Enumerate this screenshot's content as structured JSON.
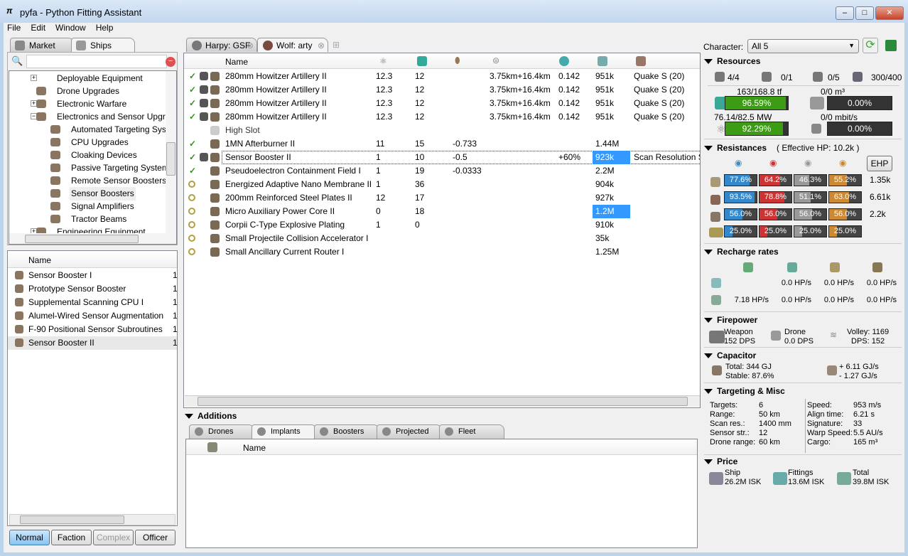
{
  "window": {
    "title": "pyfa - Python Fitting Assistant",
    "min": "–",
    "max": "□",
    "close": "✕"
  },
  "menu": [
    "File",
    "Edit",
    "Window",
    "Help"
  ],
  "left": {
    "tabs": [
      "Market",
      "Ships"
    ],
    "search_placeholder": "",
    "tree": [
      {
        "label": "Deployable Equipment",
        "level": 0,
        "expander": "+"
      },
      {
        "label": "Drone Upgrades",
        "level": 0,
        "expander": ""
      },
      {
        "label": "Electronic Warfare",
        "level": 0,
        "expander": "+"
      },
      {
        "label": "Electronics and Sensor Upgrad",
        "level": 0,
        "expander": "−"
      },
      {
        "label": "Automated Targeting Syst",
        "level": 1
      },
      {
        "label": "CPU Upgrades",
        "level": 1
      },
      {
        "label": "Cloaking Devices",
        "level": 1
      },
      {
        "label": "Passive Targeting Systems",
        "level": 1
      },
      {
        "label": "Remote Sensor Boosters",
        "level": 1
      },
      {
        "label": "Sensor Boosters",
        "level": 1,
        "selected": true
      },
      {
        "label": "Signal Amplifiers",
        "level": 1
      },
      {
        "label": "Tractor Beams",
        "level": 1
      },
      {
        "label": "Engineering Equipment",
        "level": 0,
        "expander": "+"
      }
    ],
    "list_header": "Name",
    "items": [
      {
        "name": "Sensor Booster I",
        "meta": "1"
      },
      {
        "name": "Prototype Sensor Booster",
        "meta": "1"
      },
      {
        "name": "Supplemental Scanning CPU I",
        "meta": "1"
      },
      {
        "name": "Alumel-Wired Sensor Augmentation",
        "meta": "1"
      },
      {
        "name": "F-90 Positional Sensor Subroutines",
        "meta": "1"
      },
      {
        "name": "Sensor Booster II",
        "meta": "1",
        "selected": true
      }
    ],
    "meta_buttons": [
      "Normal",
      "Faction",
      "Complex",
      "Officer"
    ]
  },
  "fit_tabs": [
    "Harpy: GSF",
    "Wolf: arty"
  ],
  "fitting": {
    "header": "Name",
    "rows": [
      {
        "state": "on",
        "name": "280mm Howitzer Artillery II",
        "cpu": "12.3",
        "pg": "12",
        "cap": "",
        "range": "3.75km+16.4km",
        "misc": "0.142",
        "price": "951k",
        "charge": "Quake S (20)"
      },
      {
        "state": "on",
        "name": "280mm Howitzer Artillery II",
        "cpu": "12.3",
        "pg": "12",
        "cap": "",
        "range": "3.75km+16.4km",
        "misc": "0.142",
        "price": "951k",
        "charge": "Quake S (20)"
      },
      {
        "state": "on",
        "name": "280mm Howitzer Artillery II",
        "cpu": "12.3",
        "pg": "12",
        "cap": "",
        "range": "3.75km+16.4km",
        "misc": "0.142",
        "price": "951k",
        "charge": "Quake S (20)"
      },
      {
        "state": "on",
        "name": "280mm Howitzer Artillery II",
        "cpu": "12.3",
        "pg": "12",
        "cap": "",
        "range": "3.75km+16.4km",
        "misc": "0.142",
        "price": "951k",
        "charge": "Quake S (20)"
      },
      {
        "state": "",
        "name": "High Slot",
        "cpu": "",
        "pg": "",
        "cap": "",
        "range": "",
        "misc": "",
        "price": "",
        "charge": ""
      },
      {
        "state": "on",
        "name": "1MN Afterburner II",
        "cpu": "11",
        "pg": "15",
        "cap": "-0.733",
        "range": "",
        "misc": "",
        "price": "1.44M",
        "charge": ""
      },
      {
        "state": "on",
        "name": "Sensor Booster II",
        "cpu": "1",
        "pg": "10",
        "cap": "-0.5",
        "range": "",
        "misc": "+60%",
        "price": "923k",
        "charge": "Scan Resolution S",
        "selected": true
      },
      {
        "state": "on",
        "name": "Pseudoelectron Containment Field I",
        "cpu": "1",
        "pg": "19",
        "cap": "-0.0333",
        "range": "",
        "misc": "",
        "price": "2.2M",
        "charge": ""
      },
      {
        "state": "passive",
        "name": "Energized Adaptive Nano Membrane II",
        "cpu": "1",
        "pg": "36",
        "cap": "",
        "range": "",
        "misc": "",
        "price": "904k",
        "charge": ""
      },
      {
        "state": "passive",
        "name": "200mm Reinforced Steel Plates II",
        "cpu": "12",
        "pg": "17",
        "cap": "",
        "range": "",
        "misc": "",
        "price": "927k",
        "charge": ""
      },
      {
        "state": "passive",
        "name": "Micro Auxiliary Power Core II",
        "cpu": "0",
        "pg": "18",
        "cap": "",
        "range": "",
        "misc": "",
        "price": "1.2M",
        "charge": "",
        "price_hl": true
      },
      {
        "state": "passive",
        "name": "Corpii C-Type Explosive Plating",
        "cpu": "1",
        "pg": "0",
        "cap": "",
        "range": "",
        "misc": "",
        "price": "910k",
        "charge": ""
      },
      {
        "state": "passive",
        "name": "Small Projectile Collision Accelerator I",
        "cpu": "",
        "pg": "",
        "cap": "",
        "range": "",
        "misc": "",
        "price": "35k",
        "charge": ""
      },
      {
        "state": "passive",
        "name": "Small Ancillary Current Router I",
        "cpu": "",
        "pg": "",
        "cap": "",
        "range": "",
        "misc": "",
        "price": "1.25M",
        "charge": ""
      }
    ]
  },
  "additions": {
    "title": "Additions",
    "tabs": [
      "Drones",
      "Implants",
      "Boosters",
      "Projected",
      "Fleet"
    ],
    "header": "Name"
  },
  "stats": {
    "character_label": "Character:",
    "character": "All 5",
    "resources": {
      "title": "Resources",
      "hardpoints": [
        "4/4",
        "0/1",
        "0/5",
        "300/400"
      ],
      "cpu": {
        "text": "163/168.8 tf",
        "pct": "96.59%",
        "value": 96.59
      },
      "pg": {
        "text": "76.14/82.5 MW",
        "pct": "92.29%",
        "value": 92.29
      },
      "drone_bay": {
        "text": "0/0 m³",
        "pct": "0.00%",
        "value": 0
      },
      "bandwidth": {
        "text": "0/0 mbit/s",
        "pct": "0.00%",
        "value": 0
      }
    },
    "resistances": {
      "title": "Resistances",
      "ehp": "( Effective HP: 10.2k )",
      "ehp_button": "EHP",
      "rows": [
        {
          "vals": [
            "77.6%",
            "64.2%",
            "46.3%",
            "55.2%"
          ],
          "nums": [
            77.6,
            64.2,
            46.3,
            55.2
          ],
          "hp": "1.35k"
        },
        {
          "vals": [
            "93.5%",
            "78.8%",
            "51.1%",
            "63.0%"
          ],
          "nums": [
            93.5,
            78.8,
            51.1,
            63.0
          ],
          "hp": "6.61k"
        },
        {
          "vals": [
            "56.0%",
            "56.0%",
            "56.0%",
            "56.0%"
          ],
          "nums": [
            56,
            56,
            56,
            56
          ],
          "hp": "2.2k"
        },
        {
          "vals": [
            "25.0%",
            "25.0%",
            "25.0%",
            "25.0%"
          ],
          "nums": [
            25,
            25,
            25,
            25
          ],
          "hp": ""
        }
      ],
      "colors": [
        "#3388cc",
        "#cc3333",
        "#999999",
        "#cc8833"
      ]
    },
    "recharge": {
      "title": "Recharge rates",
      "rows": [
        [
          "",
          "0.0 HP/s",
          "0.0 HP/s",
          "0.0 HP/s"
        ],
        [
          "7.18 HP/s",
          "0.0 HP/s",
          "0.0 HP/s",
          "0.0 HP/s"
        ]
      ]
    },
    "firepower": {
      "title": "Firepower",
      "weapon_label": "Weapon",
      "weapon": "152 DPS",
      "drone_label": "Drone",
      "drone": "0.0 DPS",
      "volley": "Volley: 1169",
      "dps": "DPS: 152"
    },
    "capacitor": {
      "title": "Capacitor",
      "total": "Total:  344 GJ",
      "stable": "Stable:  87.6%",
      "plus": "+ 6.11 GJ/s",
      "minus": "-  1.27 GJ/s"
    },
    "targeting": {
      "title": "Targeting & Misc",
      "left": [
        [
          "Targets:",
          "6"
        ],
        [
          "Range:",
          "50 km"
        ],
        [
          "Scan res.:",
          "1400 mm"
        ],
        [
          "Sensor str.:",
          "12"
        ],
        [
          "Drone range:",
          "60 km"
        ]
      ],
      "right": [
        [
          "Speed:",
          "953 m/s"
        ],
        [
          "Align time:",
          "6.21 s"
        ],
        [
          "Signature:",
          "33"
        ],
        [
          "Warp Speed:",
          "5.5 AU/s"
        ],
        [
          "Cargo:",
          "165 m³"
        ]
      ]
    },
    "price": {
      "title": "Price",
      "ship_label": "Ship",
      "ship": "26.2M ISK",
      "fittings_label": "Fittings",
      "fittings": "13.6M ISK",
      "total_label": "Total",
      "total": "39.8M ISK"
    }
  }
}
